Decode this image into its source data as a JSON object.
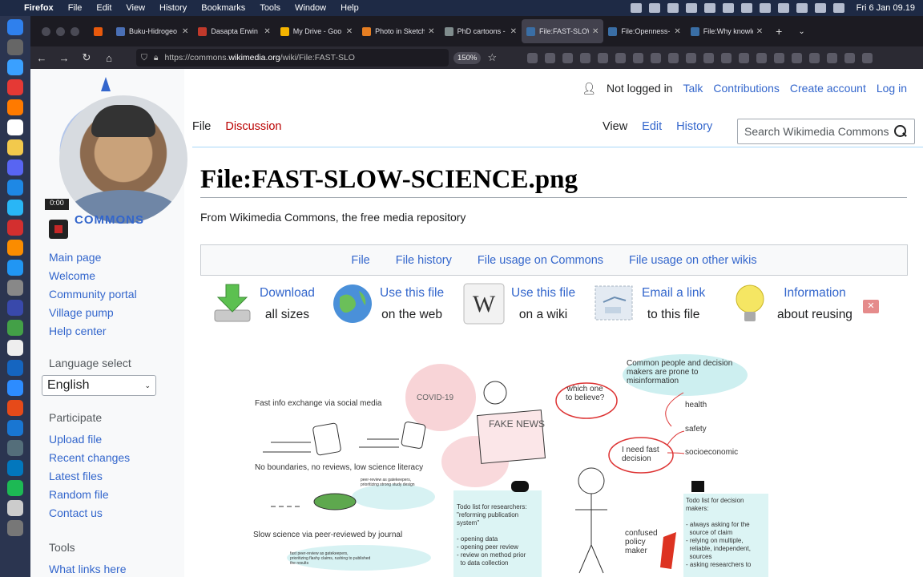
{
  "menubar": {
    "app": "Firefox",
    "items": [
      "File",
      "Edit",
      "View",
      "History",
      "Bookmarks",
      "Tools",
      "Window",
      "Help"
    ],
    "clock": "Fri 6 Jan  09.19"
  },
  "tabs": [
    {
      "title": "Buku-Hidrogeo",
      "color": "#4a6fb5"
    },
    {
      "title": "Dasapta Erwin",
      "color": "#c0392b"
    },
    {
      "title": "My Drive - Goo",
      "color": "#f4b400"
    },
    {
      "title": "Photo in Sketch",
      "color": "#e67e22"
    },
    {
      "title": "PhD cartoons -",
      "color": "#7f8c8d"
    },
    {
      "title": "File:FAST-SLOW",
      "color": "#3a6ea5"
    },
    {
      "title": "File:Openness-",
      "color": "#3a6ea5"
    },
    {
      "title": "File:Why knowle",
      "color": "#3a6ea5"
    }
  ],
  "active_tab": 5,
  "navbar": {
    "url_prefix": "https://commons.",
    "url_host": "wikimedia.org",
    "url_path": "/wiki/File:FAST-SLO",
    "zoom": "150%"
  },
  "webcam": {
    "timer": "0:00"
  },
  "logo_text": "COMMONS",
  "sidebar": {
    "nav": [
      "Main page",
      "Welcome",
      "Community portal",
      "Village pump",
      "Help center"
    ],
    "language_heading": "Language select",
    "language_value": "English",
    "participate_heading": "Participate",
    "participate": [
      "Upload file",
      "Recent changes",
      "Latest files",
      "Random file",
      "Contact us"
    ],
    "tools_heading": "Tools",
    "tools": [
      "What links here"
    ]
  },
  "personal": {
    "not_logged": "Not logged in",
    "links": [
      "Talk",
      "Contributions",
      "Create account",
      "Log in"
    ]
  },
  "content_tabs": {
    "file": "File",
    "discussion": "Discussion"
  },
  "view_tabs": {
    "view": "View",
    "edit": "Edit",
    "history": "History"
  },
  "search": {
    "placeholder": "Search Wikimedia Commons"
  },
  "page": {
    "title": "File:FAST-SLOW-SCIENCE.png",
    "tagline": "From Wikimedia Commons, the free media repository"
  },
  "file_toc": [
    "File",
    "File history",
    "File usage on Commons",
    "File usage on other wikis"
  ],
  "tools_row": [
    {
      "l1": "Download",
      "l2": "all sizes"
    },
    {
      "l1": "Use this file",
      "l2": "on the web"
    },
    {
      "l1": "Use this file",
      "l2": "on a wiki"
    },
    {
      "l1": "Email a link",
      "l2": "to this file"
    },
    {
      "l1": "Information",
      "l2": "about reusing"
    }
  ],
  "image_text": {
    "fast_info": "Fast info exchange via social media",
    "covid": "COVID-19",
    "which": "which one\nto believe?",
    "common": "Common people and decision\nmakers are prone to\nmisinformation",
    "health": "health",
    "safety": "safety",
    "socio": "socioeconomic",
    "need_fast": "I need fast\ndecision",
    "no_bound": "No boundaries, no reviews, low science literacy",
    "fake_news": "FAKE NEWS",
    "peer_small": "peer-review as gatekeepers,\nprioritizing strong study design",
    "slow_sci": "Slow science via peer-reviewed by journal",
    "fast_peer": "fast peer-review as gatekeepers,\nprioritizing flashy claims, rushing to published\nthe results",
    "todo_res": "Todo list for researchers:\n\"reforming publication\nsystem\"\n\n- opening data\n- opening peer review\n- review on method prior\n  to data collection",
    "confused": "confused\npolicy\nmaker",
    "todo_dec": "Todo list for decision\nmakers:\n\n- always asking for the\n  source of claim\n- relying on multiple,\n  reliable, independent,\n  sources\n- asking researchers to"
  }
}
